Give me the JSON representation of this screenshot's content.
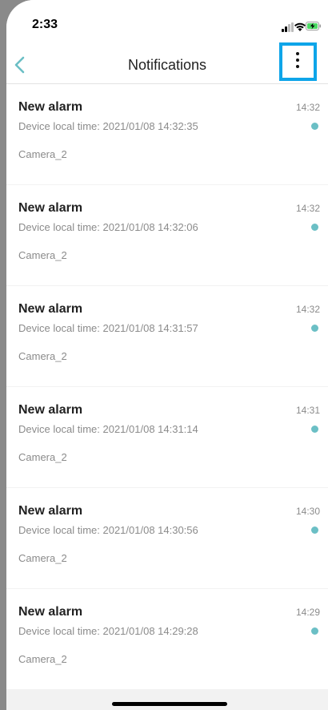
{
  "status_bar": {
    "time": "2:33",
    "icons": [
      "signal-icon",
      "wifi-icon",
      "battery-charging-icon"
    ]
  },
  "nav": {
    "title": "Notifications",
    "back_icon": "chevron-left-icon",
    "more_icon": "vertical-ellipsis-icon"
  },
  "colors": {
    "accent": "#6bbfc5",
    "highlight_box": "#0ea5e9",
    "battery": "#4cd964"
  },
  "notifications": [
    {
      "title": "New alarm",
      "desc": "Device local time: 2021/01/08 14:32:35",
      "camera": "Camera_2",
      "time": "14:32",
      "unread": true
    },
    {
      "title": "New alarm",
      "desc": "Device local time: 2021/01/08 14:32:06",
      "camera": "Camera_2",
      "time": "14:32",
      "unread": true
    },
    {
      "title": "New alarm",
      "desc": "Device local time: 2021/01/08 14:31:57",
      "camera": "Camera_2",
      "time": "14:32",
      "unread": true
    },
    {
      "title": "New alarm",
      "desc": "Device local time: 2021/01/08 14:31:14",
      "camera": "Camera_2",
      "time": "14:31",
      "unread": true
    },
    {
      "title": "New alarm",
      "desc": "Device local time: 2021/01/08 14:30:56",
      "camera": "Camera_2",
      "time": "14:30",
      "unread": true
    },
    {
      "title": "New alarm",
      "desc": "Device local time: 2021/01/08 14:29:28",
      "camera": "Camera_2",
      "time": "14:29",
      "unread": true
    }
  ]
}
